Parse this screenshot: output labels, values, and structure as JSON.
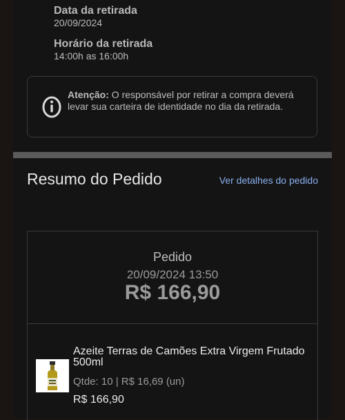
{
  "pickup": {
    "date_label": "Data da retirada",
    "date_value": "20/09/2024",
    "time_label": "Horário da retirada",
    "time_value": "14:00h as 16:00h"
  },
  "alert": {
    "icon": "info-icon",
    "title": "Atenção:",
    "message": " O responsável por retirar a compra deverá levar sua carteira de identidade no dia da retirada."
  },
  "summary": {
    "title": "Resumo do Pedido",
    "details_link": "Ver detalhes do pedido"
  },
  "order": {
    "label": "Pedido",
    "datetime": "20/09/2024 13:50",
    "total": "R$ 166,90"
  },
  "items": [
    {
      "name": "Azeite Terras de Camões Extra Virgem Frutado 500ml",
      "quantity_text": "Qtde: 10 | R$ 16,69 (un)",
      "price": "R$ 166,90",
      "image": "olive-oil-bottle"
    }
  ],
  "colors": {
    "accent_link": "#8ab0f0",
    "background": "#141414",
    "divider": "#5b5b5b"
  }
}
